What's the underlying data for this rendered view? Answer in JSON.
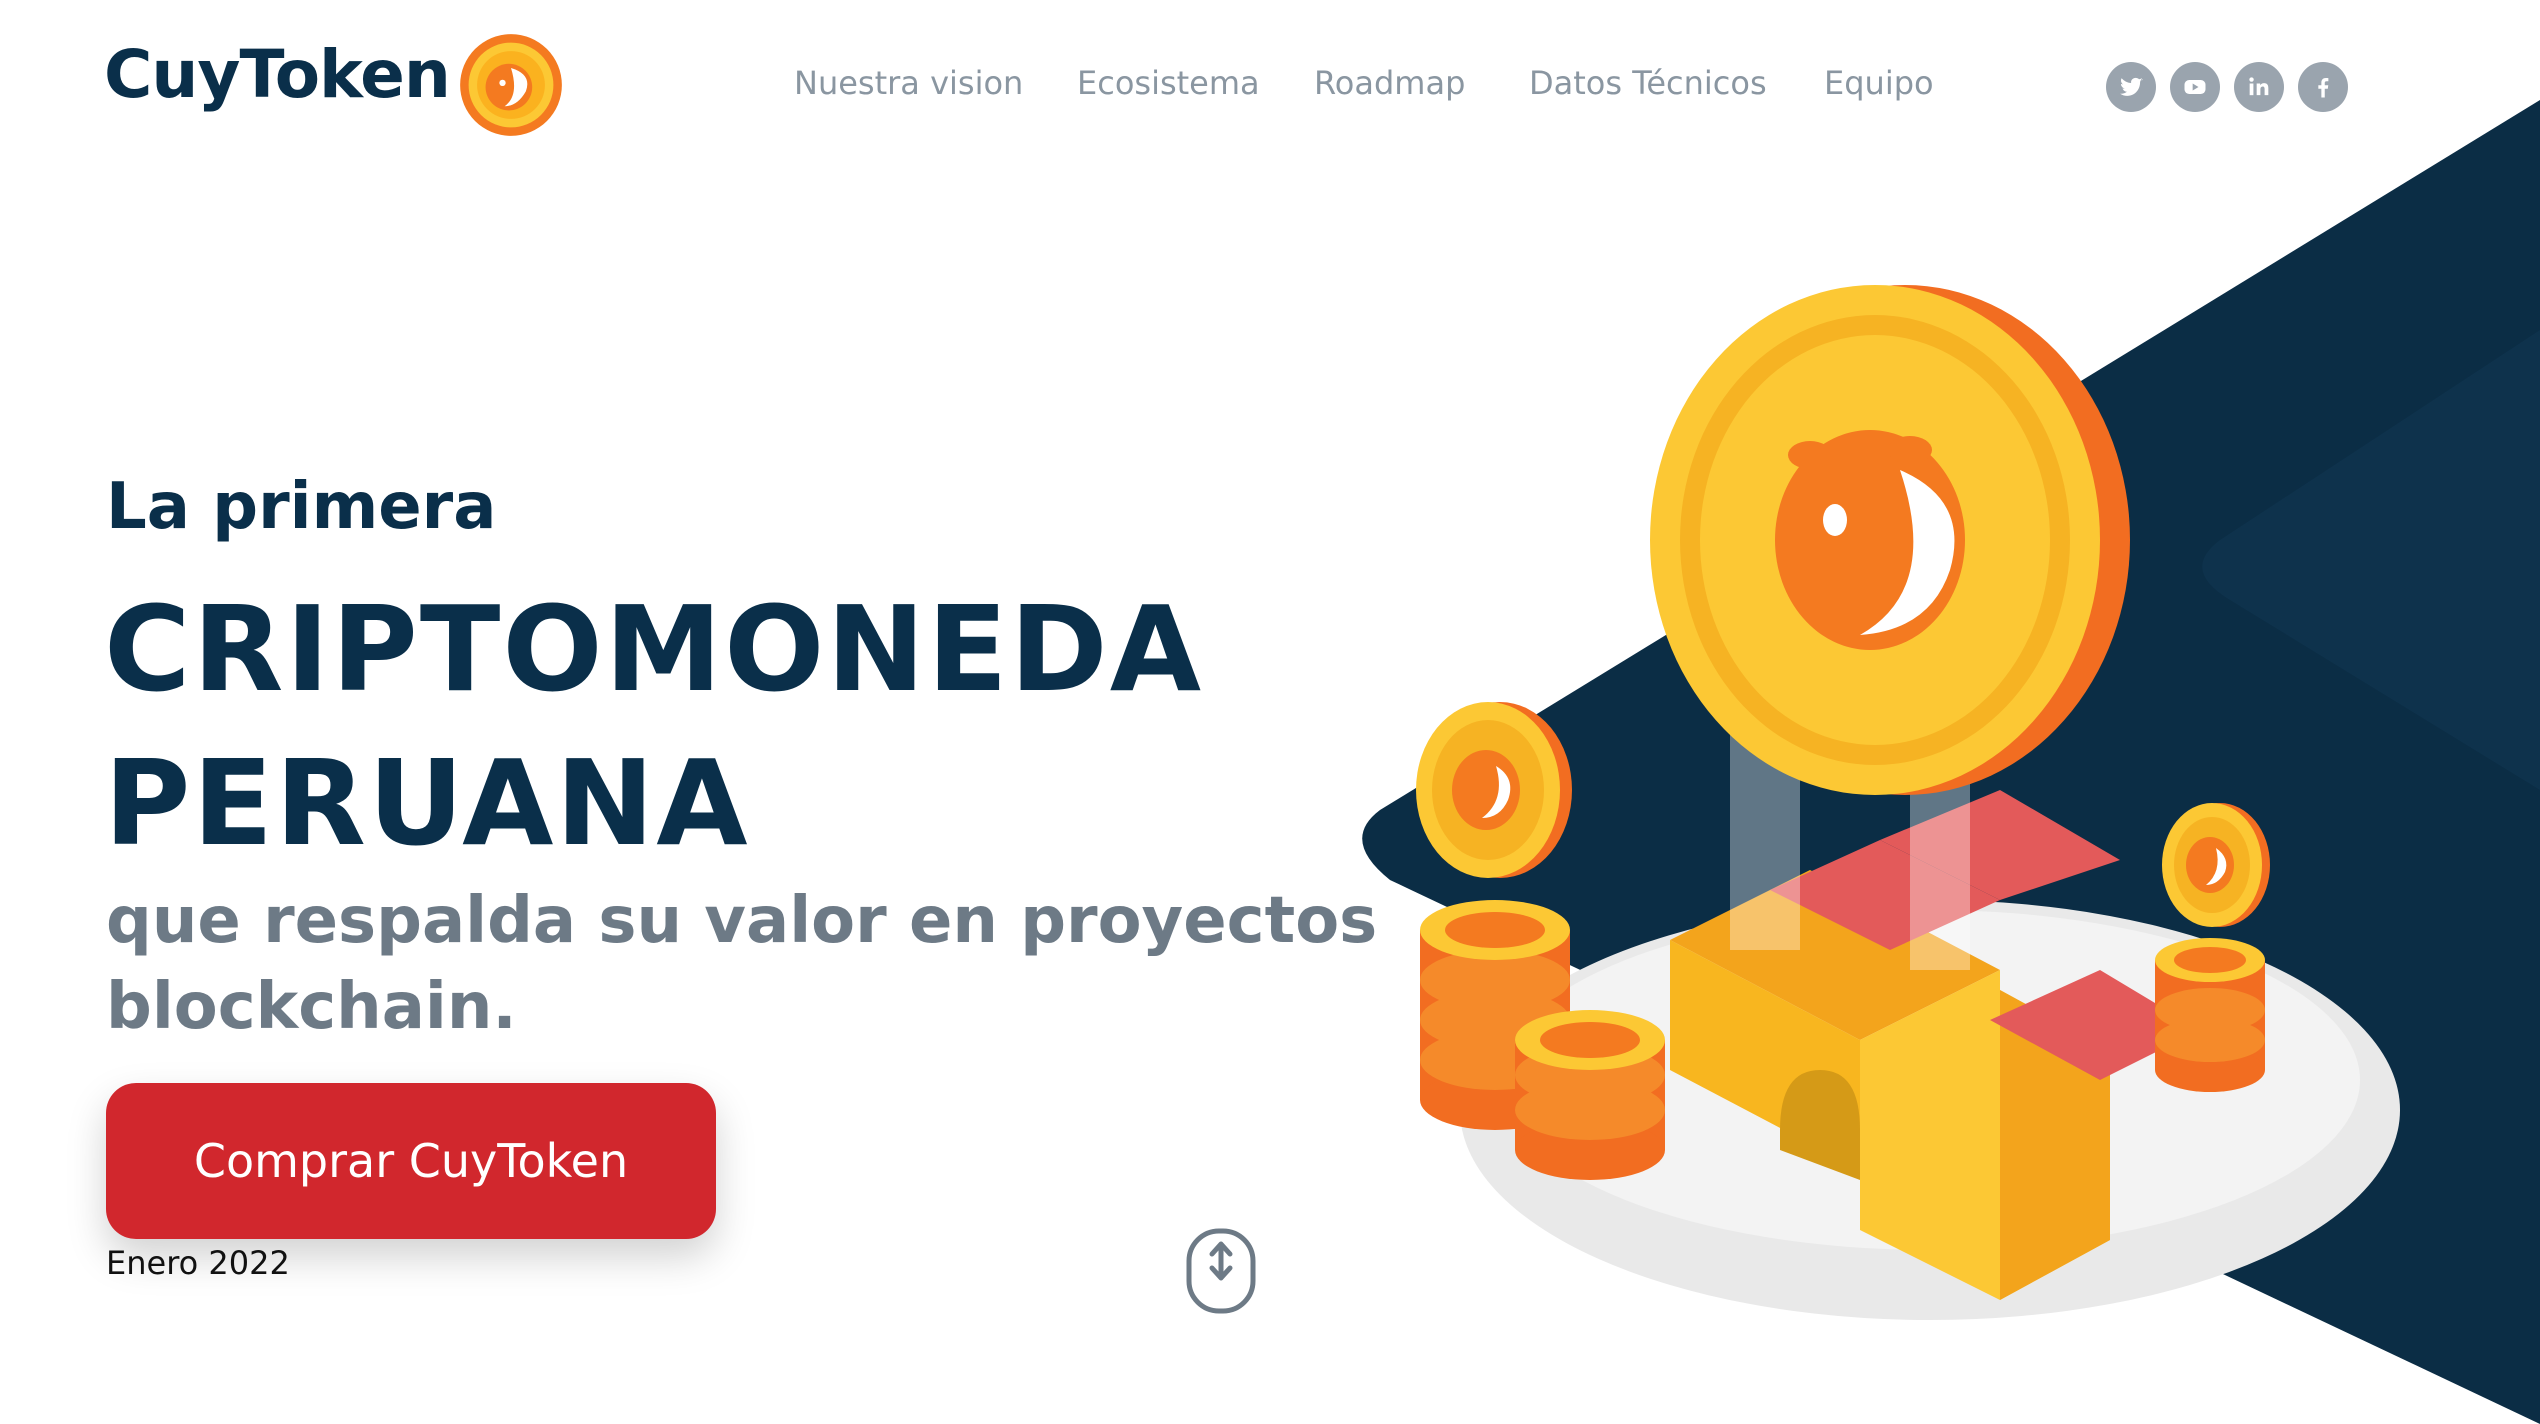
{
  "brand": {
    "name": "CuyToken"
  },
  "nav": {
    "items": [
      {
        "label": "Nuestra vision"
      },
      {
        "label": "Ecosistema"
      },
      {
        "label": "Roadmap"
      },
      {
        "label": "Datos Técnicos"
      },
      {
        "label": "Equipo"
      }
    ]
  },
  "social": [
    {
      "icon": "twitter-icon"
    },
    {
      "icon": "youtube-icon"
    },
    {
      "icon": "linkedin-icon"
    },
    {
      "icon": "facebook-icon"
    }
  ],
  "hero": {
    "kicker": "La primera",
    "headline_line1": "CRIPTOMONEDA",
    "headline_line2": "PERUANA",
    "subtitle": "que respalda su valor en proyectos blockchain.",
    "cta_label": "Comprar CuyToken",
    "date": "Enero 2022"
  },
  "colors": {
    "navy": "#0a2f4a",
    "cta_red": "#d1272d",
    "coin_gold": "#fcc834",
    "coin_orange": "#f47a20",
    "nav_gray": "#8a96a1"
  }
}
